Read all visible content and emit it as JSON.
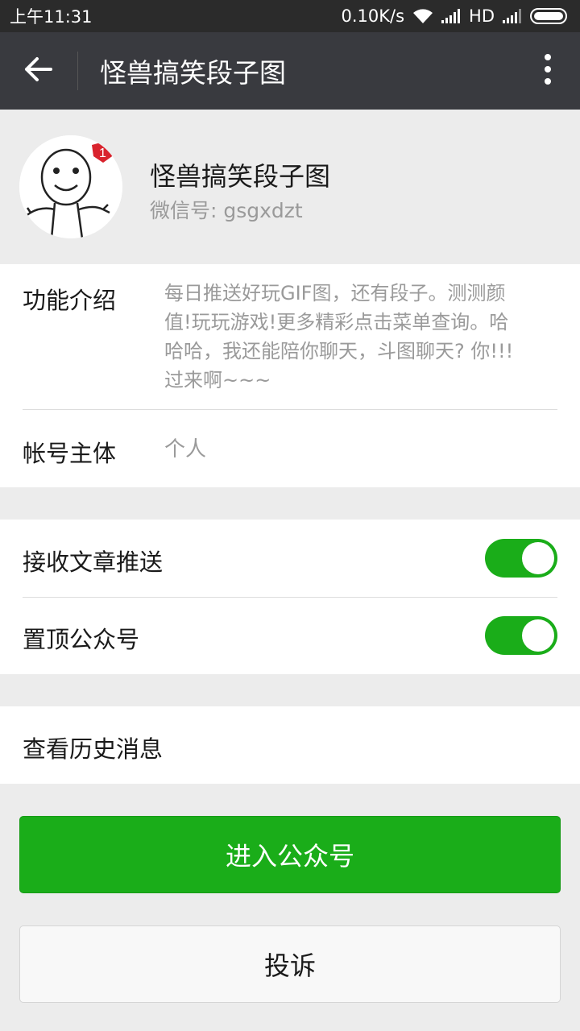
{
  "status_bar": {
    "time": "上午11:31",
    "net_speed": "0.10K/s",
    "network_type": "HD",
    "icons": [
      "wifi-icon",
      "signal-icon",
      "signal-icon",
      "battery-icon"
    ]
  },
  "app_bar": {
    "title": "怪兽搞笑段子图",
    "back_icon": "back-arrow-icon",
    "more_icon": "more-vertical-icon"
  },
  "profile": {
    "name": "怪兽搞笑段子图",
    "wechat_id": "微信号: gsgxdzt",
    "avatar": "cartoon-avatar"
  },
  "info": {
    "intro_label": "功能介绍",
    "intro_lines": [
      "每日推送好玩GIF图，还有段子。测测颜",
      "值!玩玩游戏!更多精彩点击菜单查询。哈",
      "哈哈，我还能陪你聊天，斗图聊天? 你!!!",
      "过来啊~~~"
    ],
    "owner_label": "帐号主体",
    "owner_value": "个人"
  },
  "settings": {
    "receive_label": "接收文章推送",
    "receive_on": true,
    "pin_label": "置顶公众号",
    "pin_on": true
  },
  "history": {
    "label": "查看历史消息"
  },
  "actions": {
    "enter_label": "进入公众号",
    "report_label": "投诉"
  },
  "colors": {
    "accent": "#1aad19",
    "app_bar": "#393a3f",
    "status_bar": "#2b2b2b",
    "background": "#ececec"
  }
}
